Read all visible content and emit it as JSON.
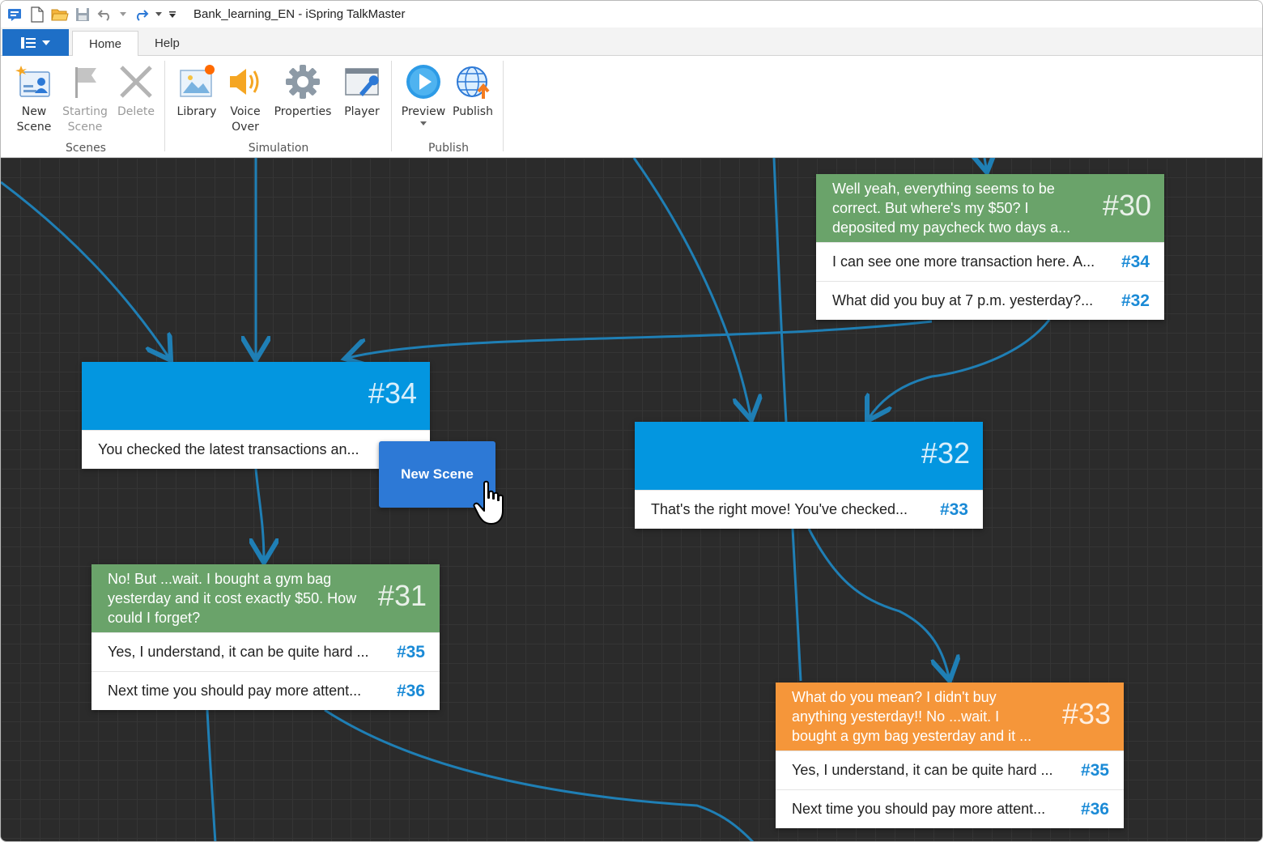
{
  "window": {
    "title": "Bank_learning_EN - iSpring TalkMaster"
  },
  "tabs": [
    {
      "label": "Home"
    },
    {
      "label": "Help"
    }
  ],
  "ribbon": {
    "groups": {
      "scenes": "Scenes",
      "simulation": "Simulation",
      "publish": "Publish"
    },
    "buttons": {
      "new_scene": [
        "New",
        "Scene"
      ],
      "starting_scene": [
        "Starting",
        "Scene"
      ],
      "delete": "Delete",
      "library": "Library",
      "voice_over": [
        "Voice",
        "Over"
      ],
      "properties": "Properties",
      "player": "Player",
      "preview": "Preview",
      "publish": "Publish"
    }
  },
  "scenes": {
    "s30": {
      "number": "#30",
      "message": "Well yeah, everything seems to be correct. But where's my $50? I deposited my paycheck two days a...",
      "responses": [
        {
          "text": "I can see one more transaction here. A...",
          "link": "#34"
        },
        {
          "text": "What did you buy at 7 p.m. yesterday?...",
          "link": "#32"
        }
      ]
    },
    "s34": {
      "number": "#34",
      "responses": [
        {
          "text": "You checked the latest transactions an..."
        }
      ]
    },
    "s32": {
      "number": "#32",
      "responses": [
        {
          "text": "That's the right move! You've checked...",
          "link": "#33"
        }
      ]
    },
    "s31": {
      "number": "#31",
      "message": "No! But ...wait. I bought a gym bag yesterday and it cost exactly $50. How could I forget?",
      "responses": [
        {
          "text": "Yes, I understand, it can be quite hard ...",
          "link": "#35"
        },
        {
          "text": "Next time you should pay more attent...",
          "link": "#36"
        }
      ]
    },
    "s33": {
      "number": "#33",
      "message": "What do you mean? I didn't buy anything yesterday!! No ...wait. I bought a gym bag yesterday and it ...",
      "responses": [
        {
          "text": "Yes, I understand, it can be quite hard ...",
          "link": "#35"
        },
        {
          "text": "Next time you should pay more attent...",
          "link": "#36"
        }
      ]
    }
  },
  "new_scene_button": "New Scene",
  "colors": {
    "accent": "#1e6fc7",
    "canvas": "#2b2b2b",
    "link_line": "#1f7fb5",
    "scene_green": "#6aa36a",
    "scene_blue": "#0396e0",
    "scene_orange": "#f5963a"
  }
}
